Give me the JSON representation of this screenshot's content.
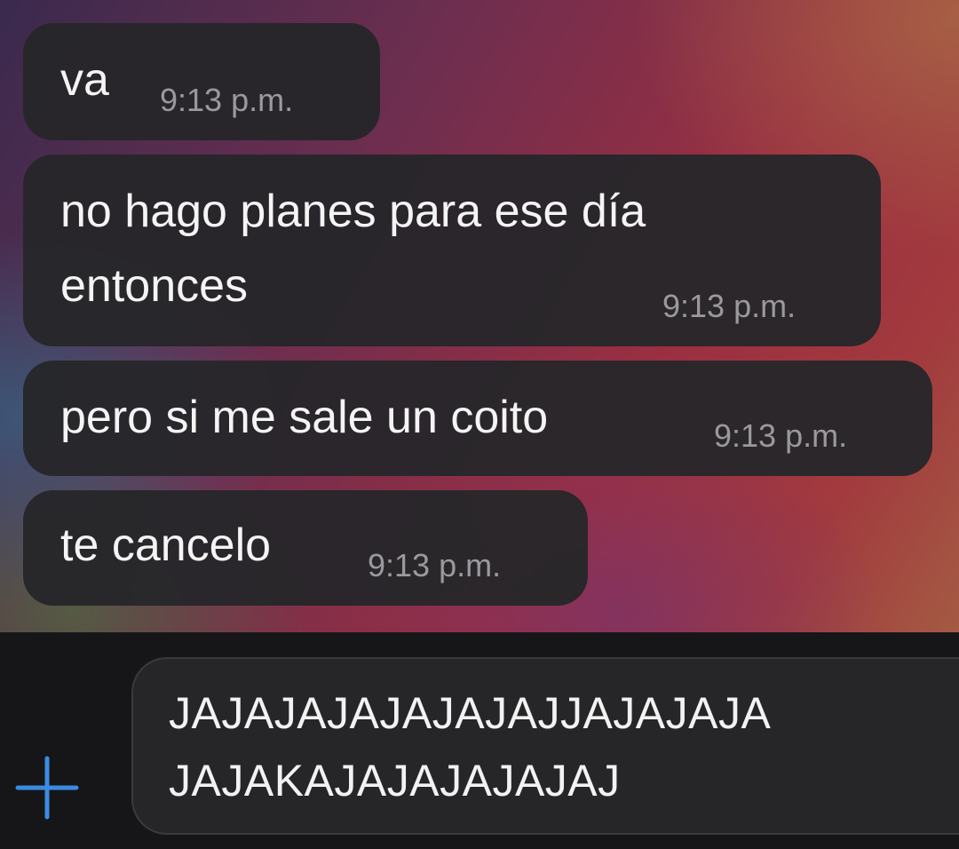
{
  "messages": [
    {
      "text": "va",
      "time": "9:13 p.m."
    },
    {
      "line1": "no hago planes para ese día",
      "line2": "entonces",
      "time": "9:13 p.m."
    },
    {
      "text": "pero si me sale un coito",
      "time": "9:13 p.m."
    },
    {
      "text": "te cancelo",
      "time": "9:13 p.m."
    }
  ],
  "composer": {
    "line1": "JAJAJAJAJAJAJAJJAJAJAJA",
    "line2": "JAJAKAJAJAJAJAJAJ",
    "plus_icon": "plus-icon",
    "accent_color": "#3b8be0"
  },
  "colors": {
    "bubble": "#26262a",
    "time": "#9a9a9e",
    "input_bg": "#262629"
  }
}
